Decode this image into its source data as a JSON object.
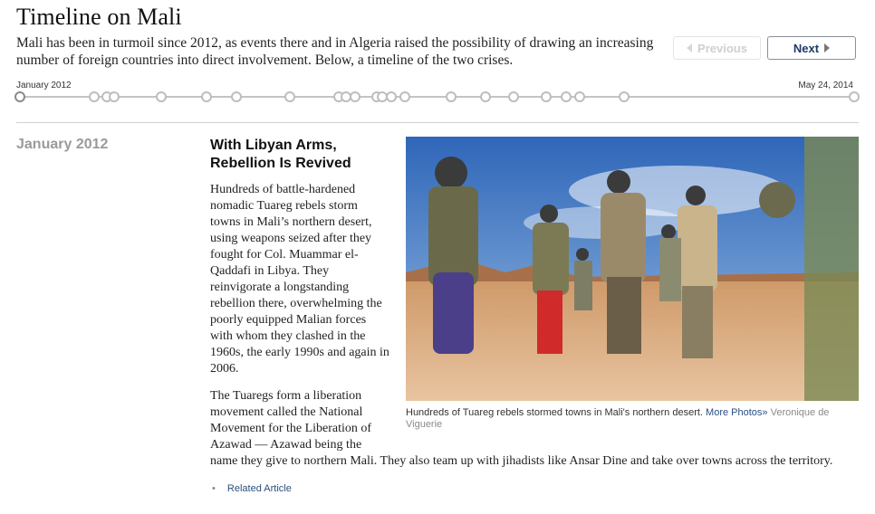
{
  "title": "Timeline on Mali",
  "intro": "Mali has been in turmoil since 2012, as events there and in Algeria raised the possibility of drawing an increasing number of foreign countries into direct involvement. Below, a timeline of the two crises.",
  "nav": {
    "previous": "Previous",
    "next": "Next",
    "previous_enabled": false
  },
  "timeline": {
    "start_label": "January 2012",
    "end_label": "May 24, 2014",
    "dot_count": 25,
    "active_index": 0
  },
  "entry": {
    "date": "January 2012",
    "headline": "With Libyan Arms, Rebellion Is Revived",
    "paragraphs": [
      "Hundreds of battle-hardened nomadic Tuareg rebels storm towns in Mali’s northern desert, using weapons seized after they fought for Col. Muammar el-Qaddafi in Libya. They reinvigorate a longstanding rebellion there, overwhelming the poorly equipped Malian forces with whom they clashed in the 1960s, the early 1990s and again in 2006.",
      "The Tuaregs form a liberation movement called the National Movement for the Liberation of Azawad — Azawad being the name they give to northern Mali. They also team up with jihadists like Ansar Dine and take over towns across the territory."
    ],
    "photo_caption": "Hundreds of Tuareg rebels stormed towns in Mali's northern desert.",
    "more_photos": "More Photos»",
    "photo_credit": "Veronique de Viguerie",
    "related_link": "Related Article"
  },
  "colors": {
    "accent_link": "#2a4f80",
    "date_gray": "#9a9a9a",
    "sky": "#4f86cc",
    "sand": "#d8a877"
  }
}
